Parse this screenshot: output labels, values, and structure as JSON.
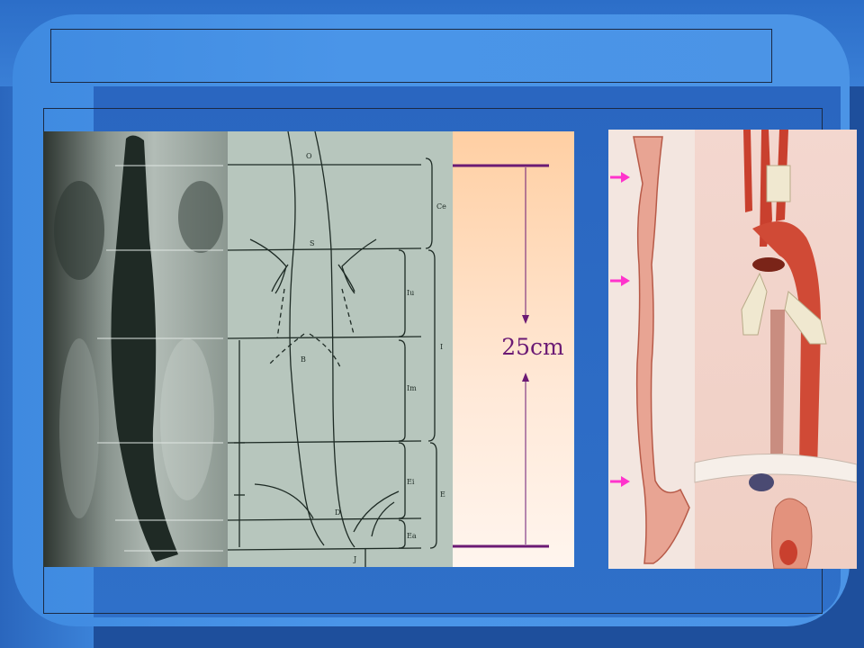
{
  "slide": {
    "title": "",
    "measurement_label": "25cm",
    "diagram_labels": {
      "o": "O",
      "s": "S",
      "b": "B",
      "d": "D",
      "j": "J",
      "ce": "Ce",
      "iu": "Iu",
      "im": "Im",
      "ei": "Ei",
      "ea": "Ea",
      "i": "I",
      "e": "E"
    }
  },
  "colors": {
    "measure_line": "#6b1a74",
    "arrow_marker": "#ff33cc",
    "background": "#1e4f9c"
  },
  "icons": {
    "arrow_markers": [
      "right-arrow-icon",
      "right-arrow-icon",
      "right-arrow-icon"
    ]
  }
}
